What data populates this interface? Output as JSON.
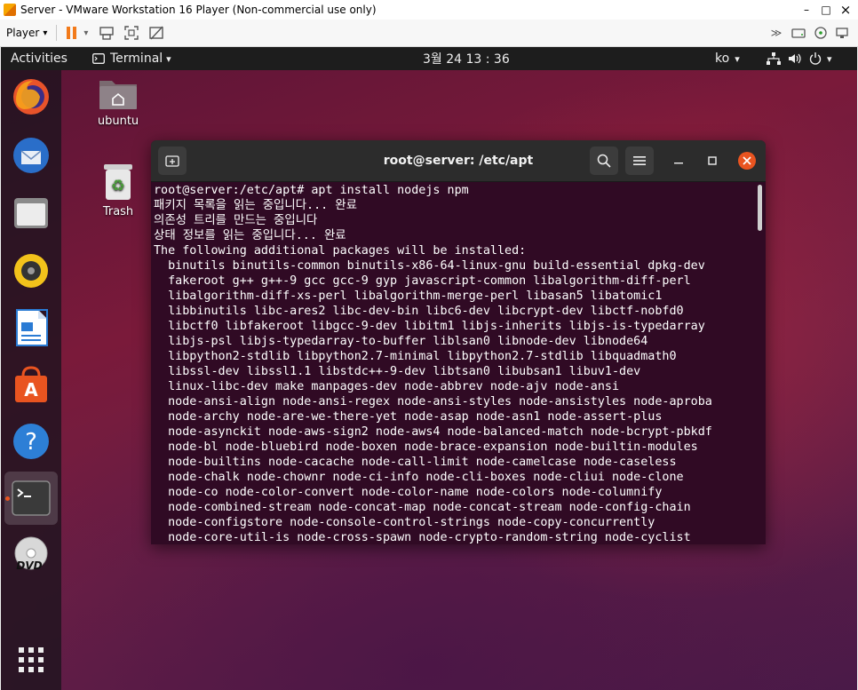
{
  "vm_window": {
    "title": "Server - VMware Workstation 16 Player (Non-commercial use only)",
    "minimize": "–",
    "maximize": "□",
    "close": "×"
  },
  "vm_toolbar": {
    "player_menu": "Player",
    "player_caret": "▾",
    "pause_caret": "▾",
    "right_more": "≫"
  },
  "topbar": {
    "activities": "Activities",
    "app_menu": "Terminal",
    "app_caret": "▾",
    "clock": "3월 24  13 : 36",
    "input_method": "ko",
    "input_caret": "▾",
    "status_caret": "▾"
  },
  "desktop": {
    "home_label": "ubuntu",
    "trash_label": "Trash"
  },
  "terminal": {
    "title": "root@server: /etc/apt",
    "lines": [
      "root@server:/etc/apt# apt install nodejs npm",
      "패키지 목록을 읽는 중입니다... 완료",
      "의존성 트리를 만드는 중입니다",
      "상태 정보를 읽는 중입니다... 완료",
      "The following additional packages will be installed:",
      "  binutils binutils-common binutils-x86-64-linux-gnu build-essential dpkg-dev",
      "  fakeroot g++ g++-9 gcc gcc-9 gyp javascript-common libalgorithm-diff-perl",
      "  libalgorithm-diff-xs-perl libalgorithm-merge-perl libasan5 libatomic1",
      "  libbinutils libc-ares2 libc-dev-bin libc6-dev libcrypt-dev libctf-nobfd0",
      "  libctf0 libfakeroot libgcc-9-dev libitm1 libjs-inherits libjs-is-typedarray",
      "  libjs-psl libjs-typedarray-to-buffer liblsan0 libnode-dev libnode64",
      "  libpython2-stdlib libpython2.7-minimal libpython2.7-stdlib libquadmath0",
      "  libssl-dev libssl1.1 libstdc++-9-dev libtsan0 libubsan1 libuv1-dev",
      "  linux-libc-dev make manpages-dev node-abbrev node-ajv node-ansi",
      "  node-ansi-align node-ansi-regex node-ansi-styles node-ansistyles node-aproba",
      "  node-archy node-are-we-there-yet node-asap node-asn1 node-assert-plus",
      "  node-asynckit node-aws-sign2 node-aws4 node-balanced-match node-bcrypt-pbkdf",
      "  node-bl node-bluebird node-boxen node-brace-expansion node-builtin-modules",
      "  node-builtins node-cacache node-call-limit node-camelcase node-caseless",
      "  node-chalk node-chownr node-ci-info node-cli-boxes node-cliui node-clone",
      "  node-co node-color-convert node-color-name node-colors node-columnify",
      "  node-combined-stream node-concat-map node-concat-stream node-config-chain",
      "  node-configstore node-console-control-strings node-copy-concurrently",
      "  node-core-util-is node-cross-spawn node-crypto-random-string node-cyclist"
    ]
  },
  "colors": {
    "terminal_bg": "#300a24",
    "header_bg": "#2c2c2c",
    "close_button": "#e95420",
    "topbar_bg": "#1d1d1d"
  }
}
